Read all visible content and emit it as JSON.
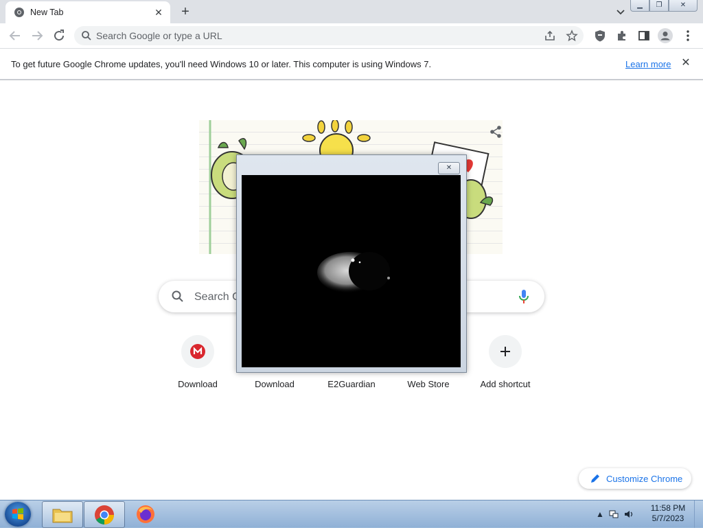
{
  "tab": {
    "title": "New Tab"
  },
  "toolbar": {
    "omnibox_placeholder": "Search Google or type a URL"
  },
  "infobar": {
    "message": "To get future Google Chrome updates, you'll need Windows 10 or later. This computer is using Windows 7.",
    "link": "Learn more"
  },
  "ntp": {
    "search_placeholder": "Search Google or type a URL",
    "shortcuts": [
      {
        "label": "Download",
        "icon": "mega-icon"
      },
      {
        "label": "Download",
        "icon": "download-icon"
      },
      {
        "label": "E2Guardian",
        "icon": "e2guardian-icon"
      },
      {
        "label": "Web Store",
        "icon": "web-store-icon"
      },
      {
        "label": "Add shortcut",
        "icon": "plus-icon"
      }
    ],
    "customize_label": "Customize Chrome"
  },
  "popup": {
    "content": "eye-video-frame"
  },
  "taskbar": {
    "apps": [
      "windows-explorer",
      "google-chrome",
      "firefox"
    ],
    "time": "11:58 PM",
    "date": "5/7/2023"
  },
  "colors": {
    "accent": "#1a73e8",
    "tabstrip": "#dee1e6",
    "taskbar": "#a7c2e2",
    "mega_red": "#d9272e"
  }
}
